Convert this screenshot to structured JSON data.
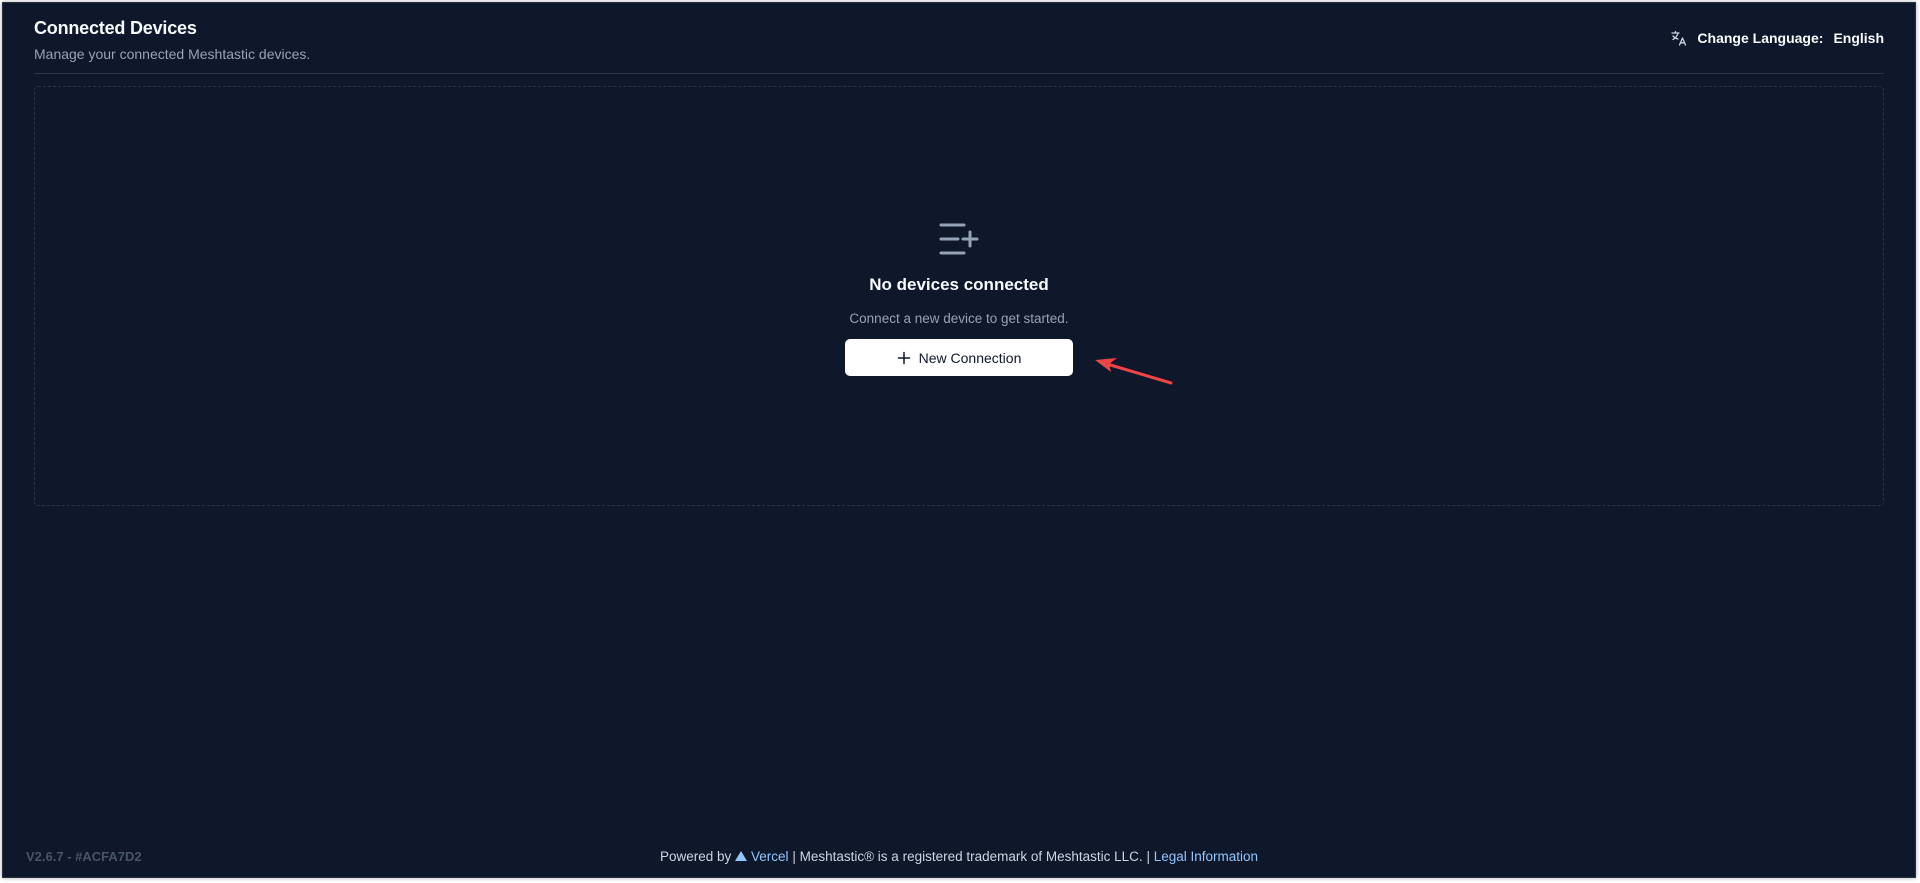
{
  "header": {
    "title": "Connected Devices",
    "subtitle": "Manage your connected Meshtastic devices.",
    "language_label": "Change Language:",
    "language_value": "English",
    "language_icon": "translate-icon"
  },
  "empty_state": {
    "icon": "list-plus-icon",
    "title": "No devices connected",
    "description": "Connect a new device to get started.",
    "button_label": "New Connection",
    "button_icon": "plus-icon"
  },
  "annotation": {
    "arrow_color": "#ef4444",
    "icon": "arrow-annotation"
  },
  "footer": {
    "version": "V2.6.7  -  #ACFA7D2",
    "powered_by": "Powered by",
    "vercel": "Vercel",
    "sep1": "|",
    "trademark": "Meshtastic® is a registered trademark of Meshtastic LLC.",
    "sep2": "|",
    "legal": "Legal Information"
  },
  "colors": {
    "background": "#0f172a",
    "link": "#93c5fd",
    "button_bg": "#ffffff"
  }
}
